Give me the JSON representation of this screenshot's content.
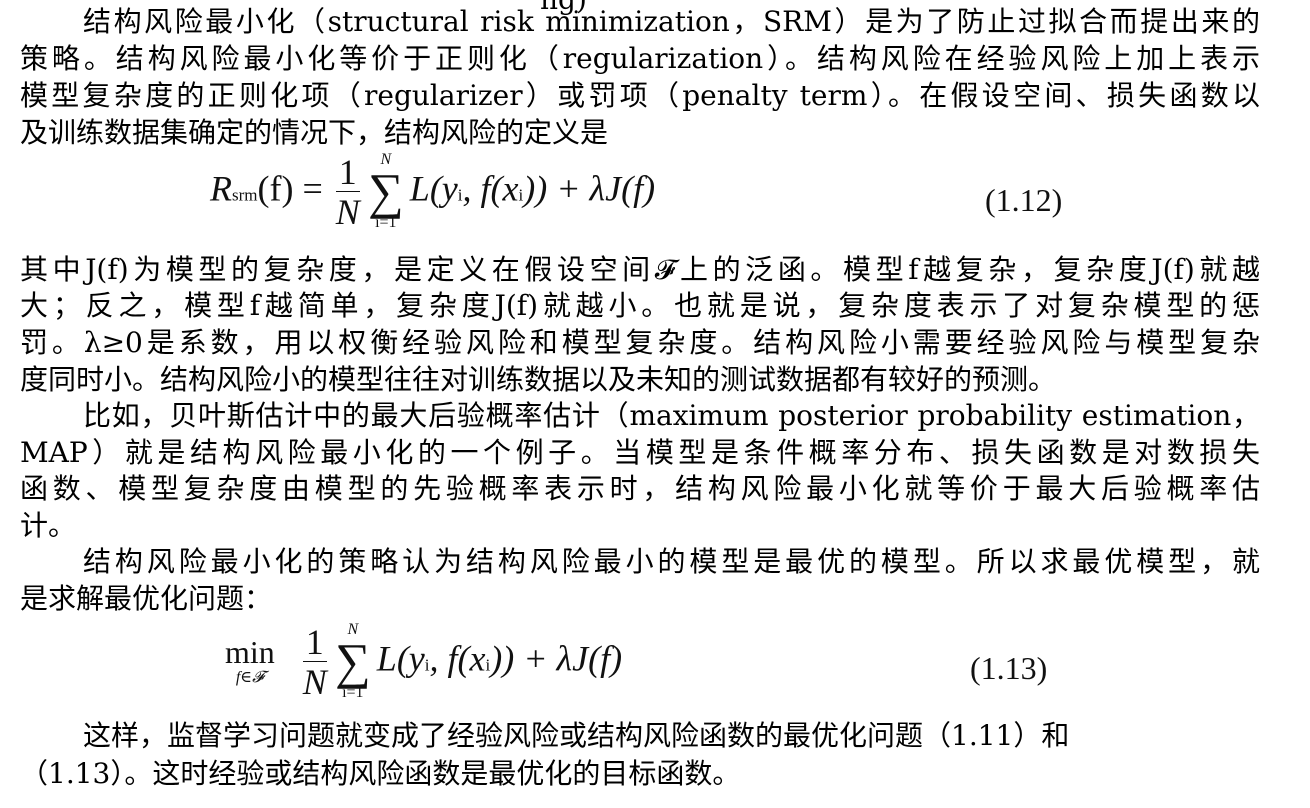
{
  "doc": {
    "top_fragment": "ng)",
    "lines": [
      "结构风险最小化（structural risk minimization，SRM）是为了防止过拟合而提出来的",
      "策略。结构风险最小化等价于正则化（regularization）。结构风险在经验风险上加上表示",
      "模型复杂度的正则化项（regularizer）或罚项（penalty term）。在假设空间、损失函数以",
      "及训练数据集确定的情况下，结构风险的定义是",
      "其中J(f)为模型的复杂度，是定义在假设空间𝓕上的泛函。模型f越复杂，复杂度J(f)就越",
      "大；反之，模型f越简单，复杂度J(f)就越小。也就是说，复杂度表示了对复杂模型的惩",
      "罚。λ≥0是系数，用以权衡经验风险和模型复杂度。结构风险小需要经验风险与模型复杂",
      "度同时小。结构风险小的模型往往对训练数据以及未知的测试数据都有较好的预测。",
      "比如，贝叶斯估计中的最大后验概率估计（maximum posterior probability estimation，",
      "MAP）就是结构风险最小化的一个例子。当模型是条件概率分布、损失函数是对数损失",
      "函数、模型复杂度由模型的先验概率表示时，结构风险最小化就等价于最大后验概率估",
      "计。",
      "结构风险最小化的策略认为结构风险最小的模型是最优的模型。所以求最优模型，就",
      "是求解最优化问题：",
      "这样，监督学习问题就变成了经验风险或结构风险函数的最优化问题（1.11）和",
      "（1.13）。这时经验或结构风险函数是最优化的目标函数。"
    ]
  },
  "eq1": {
    "R": "R",
    "R_sub": "srm",
    "lhs_rest": "(f) =",
    "num": "1",
    "den": "N",
    "sum_top": "N",
    "sum_sign": "∑",
    "sum_bot": "i=1",
    "body": "L(y",
    "body_i1": "i",
    "body_mid": ", f(x",
    "body_i2": "i",
    "body_end": ")) + λJ(f)",
    "number": "(1.12)"
  },
  "eq2": {
    "min": "min",
    "min_sub": "f∈𝓕",
    "num": "1",
    "den": "N",
    "sum_top": "N",
    "sum_sign": "∑",
    "sum_bot": "i=1",
    "body": "L(y",
    "body_i1": "i",
    "body_mid": ", f(x",
    "body_i2": "i",
    "body_end": ")) + λJ(f)",
    "number": "(1.13)"
  }
}
